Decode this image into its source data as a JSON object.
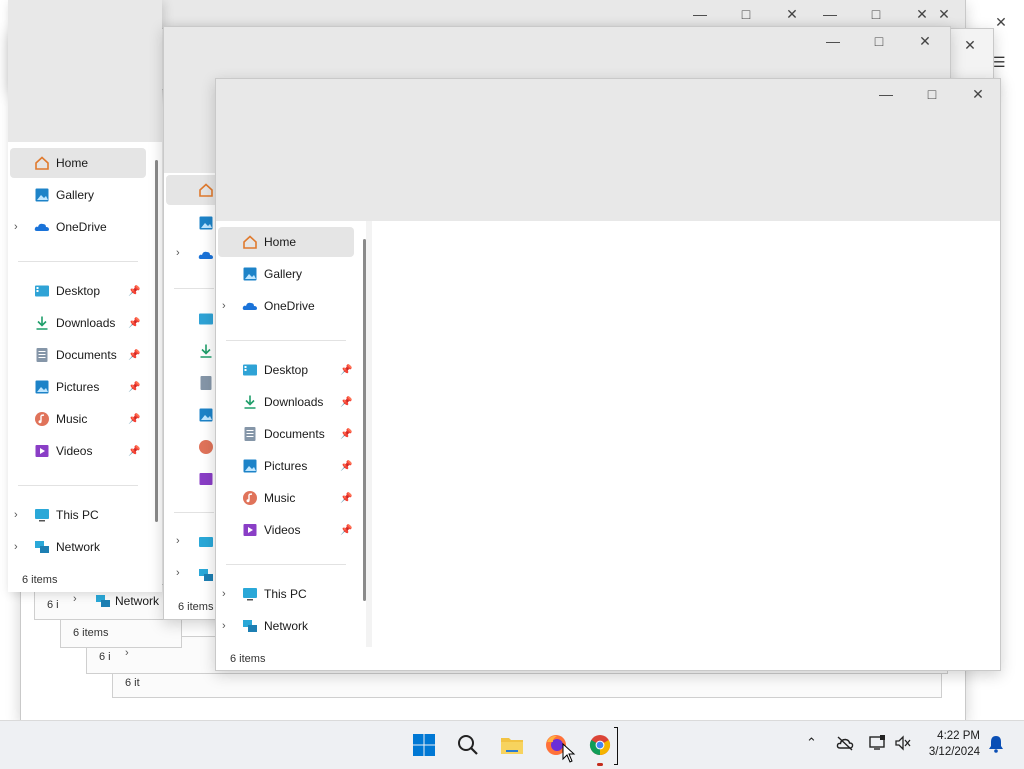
{
  "background_windows": {
    "status_text": "6 items",
    "status_partial": "6 i",
    "status_partial_2": "6 it",
    "network_label": "Network"
  },
  "window_left": {
    "nav": {
      "home": "Home",
      "gallery": "Gallery",
      "onedrive": "OneDrive",
      "desktop": "Desktop",
      "downloads": "Downloads",
      "documents": "Documents",
      "pictures": "Pictures",
      "music": "Music",
      "videos": "Videos",
      "this_pc": "This PC",
      "network": "Network"
    },
    "status": "6 items"
  },
  "window_mid": {
    "status": "6 items"
  },
  "window_front": {
    "nav": {
      "home": "Home",
      "gallery": "Gallery",
      "onedrive": "OneDrive",
      "desktop": "Desktop",
      "downloads": "Downloads",
      "documents": "Documents",
      "pictures": "Pictures",
      "music": "Music",
      "videos": "Videos",
      "this_pc": "This PC",
      "network": "Network"
    },
    "status": "6 items"
  },
  "taskbar": {
    "clock_time": "4:22 PM",
    "clock_date": "3/12/2024"
  },
  "colors": {
    "accent": "#0067c0",
    "titlebar": "#e8e8e8",
    "selected_item": "#e5e5e5"
  }
}
